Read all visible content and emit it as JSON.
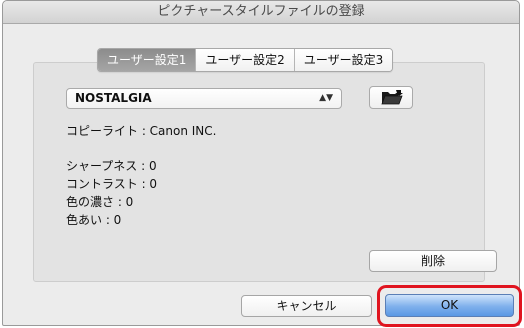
{
  "window": {
    "title": "ピクチャースタイルファイルの登録"
  },
  "tabs": [
    {
      "label": "ユーザー設定1",
      "active": true
    },
    {
      "label": "ユーザー設定2",
      "active": false
    },
    {
      "label": "ユーザー設定3",
      "active": false
    }
  ],
  "style_select": {
    "value": "NOSTALGIA",
    "arrows": "⌃⌄"
  },
  "file_button": {
    "icon": "folder-open-icon"
  },
  "info": {
    "copyright": "コピーライト : Canon INC.",
    "sharpness": "シャープネス : 0",
    "contrast": "コントラスト : 0",
    "saturation": "色の濃さ : 0",
    "color_tone": "色あい : 0"
  },
  "buttons": {
    "delete": "削除",
    "cancel": "キャンセル",
    "ok": "OK"
  },
  "colors": {
    "highlight": "#e0141f",
    "primary_button": "#6fa6ea",
    "active_tab": "#979797"
  }
}
